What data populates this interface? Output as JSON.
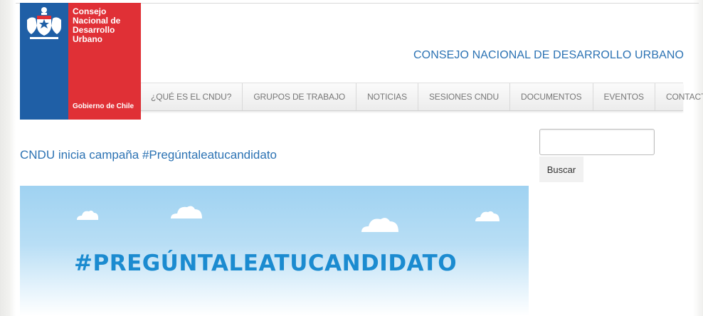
{
  "logo": {
    "title": "Consejo\nNacional de\nDesarrollo\nUrbano",
    "footer": "Gobierno de Chile",
    "colors": {
      "blue": "#1f5fa6",
      "red": "#e03036"
    }
  },
  "site": {
    "title": "CONSEJO NACIONAL DE DESARROLLO URBANO"
  },
  "nav": {
    "items": [
      {
        "label": "¿QUÉ ES EL CNDU?"
      },
      {
        "label": "GRUPOS DE TRABAJO"
      },
      {
        "label": "NOTICIAS"
      },
      {
        "label": "SESIONES CNDU"
      },
      {
        "label": "DOCUMENTOS"
      },
      {
        "label": "EVENTOS"
      },
      {
        "label": "CONTACTO"
      }
    ]
  },
  "search": {
    "value": "",
    "button_label": "Buscar"
  },
  "post": {
    "title": "CNDU inicia campaña #Pregúntaleatucandidato"
  },
  "banner": {
    "hashtag": "#PREGÚNTALEATUCANDIDATO",
    "text_color": "#1b8bd0"
  }
}
